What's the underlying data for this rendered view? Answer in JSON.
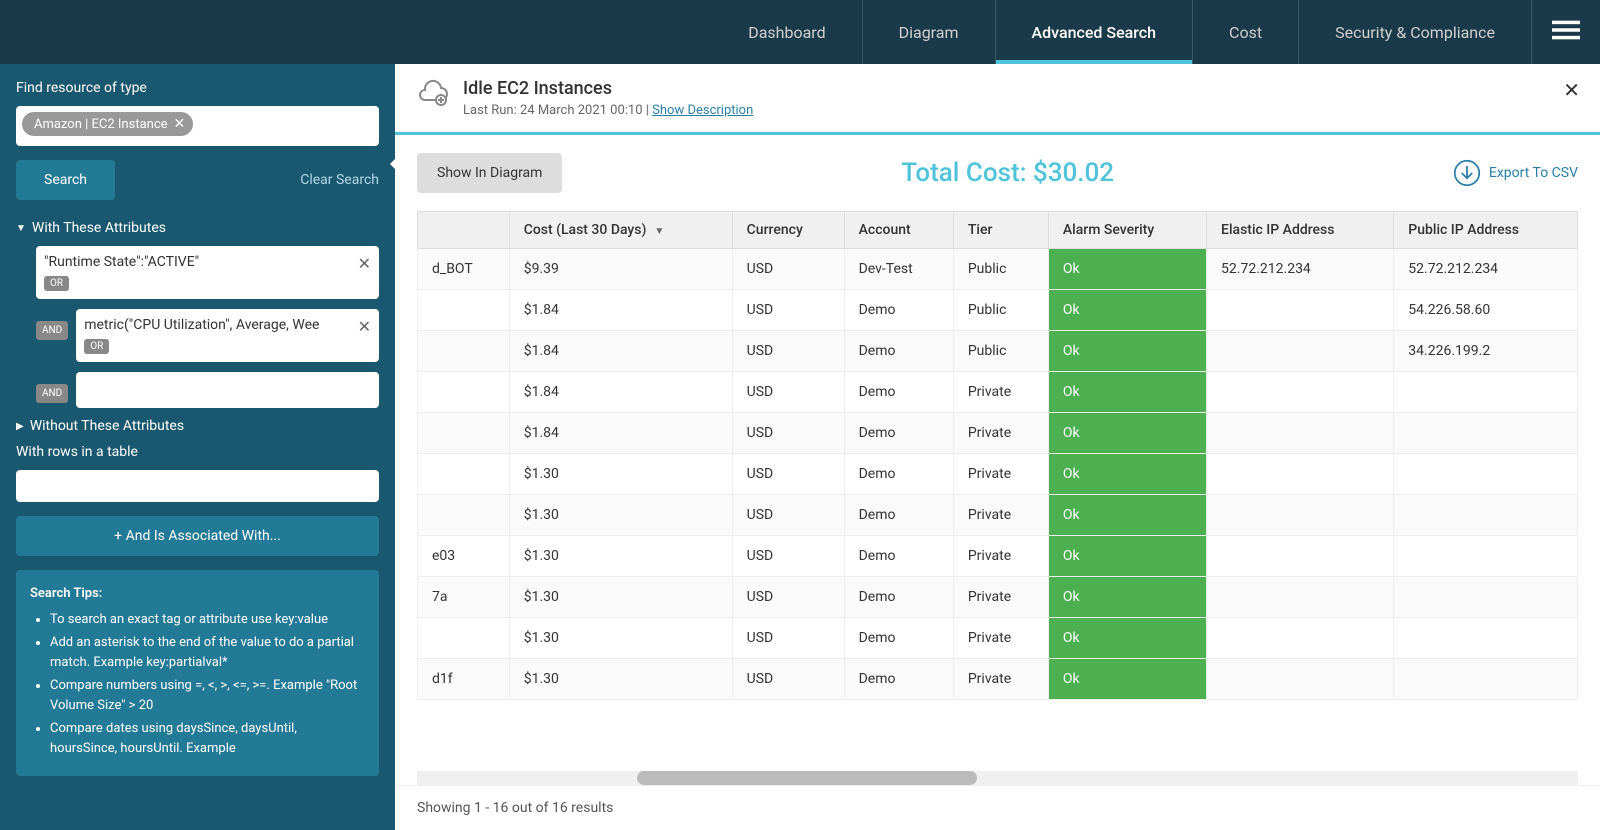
{
  "nav": {
    "items": [
      {
        "label": "Dashboard",
        "active": false
      },
      {
        "label": "Diagram",
        "active": false
      },
      {
        "label": "Advanced Search",
        "active": true
      },
      {
        "label": "Cost",
        "active": false
      },
      {
        "label": "Security & Compliance",
        "active": false
      }
    ]
  },
  "sidebar": {
    "find_label": "Find resource of type",
    "type_chip": "Amazon | EC2 Instance",
    "search_btn": "Search",
    "clear_link": "Clear Search",
    "with_attrs": "With These Attributes",
    "without_attrs": "Without These Attributes",
    "attr1": "\"Runtime State\":\"ACTIVE\"",
    "attr2": "metric(\"CPU Utilization\", Average, Wee",
    "or_label": "OR",
    "and_label": "AND",
    "rows_label": "With rows in a table",
    "assoc_btn": "+ And Is Associated With...",
    "tips_title": "Search Tips:",
    "tips": [
      "To search an exact tag or attribute use key:value",
      "Add an asterisk to the end of the value to do a partial match. Example key:partialval*",
      "Compare numbers using =, <, >, <=, >=. Example \"Root Volume Size\" > 20",
      "Compare dates using daysSince, daysUntil, hoursSince, hoursUntil. Example"
    ]
  },
  "header": {
    "title": "Idle EC2 Instances",
    "subtitle_prefix": "Last Run: 24 March 2021 00:10 | ",
    "show_desc": "Show Description"
  },
  "actions": {
    "show_diagram": "Show In Diagram",
    "total_cost": "Total Cost: $30.02",
    "export_csv": "Export To CSV"
  },
  "table": {
    "columns": [
      "Cost (Last 30 Days)",
      "Currency",
      "Account",
      "Tier",
      "Alarm Severity",
      "Elastic IP Address",
      "Public IP Address"
    ],
    "rows": [
      {
        "name_fragment": "d_BOT",
        "cost": "$9.39",
        "currency": "USD",
        "account": "Dev-Test",
        "tier": "Public",
        "alarm": "Ok",
        "elastic_ip": "52.72.212.234",
        "public_ip": "52.72.212.234"
      },
      {
        "name_fragment": "",
        "cost": "$1.84",
        "currency": "USD",
        "account": "Demo",
        "tier": "Public",
        "alarm": "Ok",
        "elastic_ip": "",
        "public_ip": "54.226.58.60"
      },
      {
        "name_fragment": "",
        "cost": "$1.84",
        "currency": "USD",
        "account": "Demo",
        "tier": "Public",
        "alarm": "Ok",
        "elastic_ip": "",
        "public_ip": "34.226.199.2"
      },
      {
        "name_fragment": "",
        "cost": "$1.84",
        "currency": "USD",
        "account": "Demo",
        "tier": "Private",
        "alarm": "Ok",
        "elastic_ip": "",
        "public_ip": ""
      },
      {
        "name_fragment": "",
        "cost": "$1.84",
        "currency": "USD",
        "account": "Demo",
        "tier": "Private",
        "alarm": "Ok",
        "elastic_ip": "",
        "public_ip": ""
      },
      {
        "name_fragment": "",
        "cost": "$1.30",
        "currency": "USD",
        "account": "Demo",
        "tier": "Private",
        "alarm": "Ok",
        "elastic_ip": "",
        "public_ip": ""
      },
      {
        "name_fragment": "",
        "cost": "$1.30",
        "currency": "USD",
        "account": "Demo",
        "tier": "Private",
        "alarm": "Ok",
        "elastic_ip": "",
        "public_ip": ""
      },
      {
        "name_fragment": "e03",
        "cost": "$1.30",
        "currency": "USD",
        "account": "Demo",
        "tier": "Private",
        "alarm": "Ok",
        "elastic_ip": "",
        "public_ip": ""
      },
      {
        "name_fragment": "7a",
        "cost": "$1.30",
        "currency": "USD",
        "account": "Demo",
        "tier": "Private",
        "alarm": "Ok",
        "elastic_ip": "",
        "public_ip": ""
      },
      {
        "name_fragment": "",
        "cost": "$1.30",
        "currency": "USD",
        "account": "Demo",
        "tier": "Private",
        "alarm": "Ok",
        "elastic_ip": "",
        "public_ip": ""
      },
      {
        "name_fragment": "d1f",
        "cost": "$1.30",
        "currency": "USD",
        "account": "Demo",
        "tier": "Private",
        "alarm": "Ok",
        "elastic_ip": "",
        "public_ip": ""
      }
    ]
  },
  "footer": {
    "showing": "Showing 1 - 16 out of 16 results"
  }
}
